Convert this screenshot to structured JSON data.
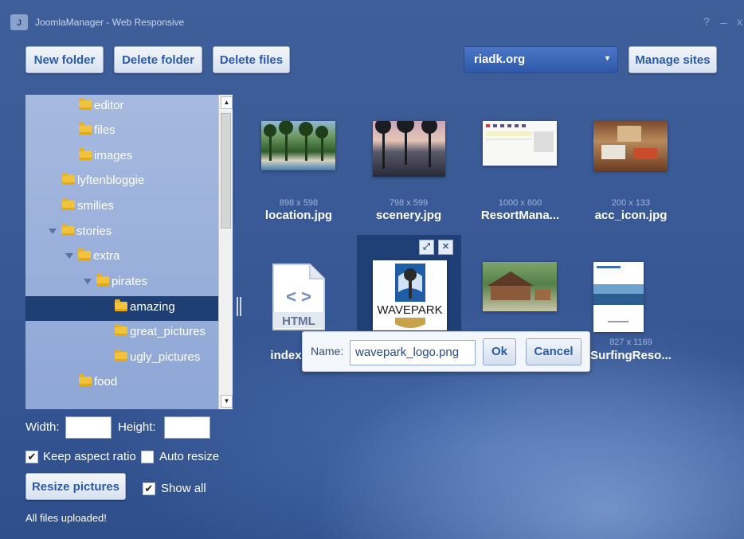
{
  "window": {
    "title": "JoomlaManager - Web Responsive",
    "icon_letter": "J",
    "help": "?",
    "minimize": "_",
    "close": "x"
  },
  "toolbar": {
    "new_folder": "New folder",
    "delete_folder": "Delete folder",
    "delete_files": "Delete files",
    "manage_sites": "Manage sites"
  },
  "site_select": {
    "value": "riadk.org",
    "arrow": "▾"
  },
  "tree": {
    "items": [
      {
        "label": "editor",
        "level": 2,
        "expanded": false,
        "selected": false
      },
      {
        "label": "files",
        "level": 2,
        "expanded": false,
        "selected": false
      },
      {
        "label": "images",
        "level": 2,
        "expanded": false,
        "selected": false
      },
      {
        "label": "lyftenbloggie",
        "level": 1,
        "expanded": false,
        "selected": false
      },
      {
        "label": "smilies",
        "level": 1,
        "expanded": false,
        "selected": false
      },
      {
        "label": "stories",
        "level": 1,
        "expanded": true,
        "selected": false
      },
      {
        "label": "extra",
        "level": 2,
        "expanded": true,
        "selected": false
      },
      {
        "label": "pirates",
        "level": 3,
        "expanded": true,
        "selected": false
      },
      {
        "label": "amazing",
        "level": 4,
        "expanded": false,
        "selected": true
      },
      {
        "label": "great_pictures",
        "level": 4,
        "expanded": false,
        "selected": false
      },
      {
        "label": "ugly_pictures",
        "level": 4,
        "expanded": false,
        "selected": false
      },
      {
        "label": "food",
        "level": 2,
        "expanded": false,
        "selected": false
      }
    ],
    "scroll_up": "▲",
    "scroll_down": "▼"
  },
  "resize": {
    "width_label": "Width:",
    "height_label": "Height:",
    "width_value": "",
    "height_value": "",
    "keep_aspect_label": "Keep aspect ratio",
    "keep_aspect_checked": true,
    "auto_resize_label": "Auto resize",
    "auto_resize_checked": false,
    "resize_button": "Resize pictures",
    "show_all_label": "Show all",
    "show_all_checked": true,
    "check_mark": "✔"
  },
  "status": "All files uploaded!",
  "files": [
    {
      "name": "location.jpg",
      "dims": "898 x 598",
      "kind": "photo-beach"
    },
    {
      "name": "scenery.jpg",
      "dims": "798 x 599",
      "kind": "photo-sunset"
    },
    {
      "name": "ResortMana...",
      "dims": "1000 x 600",
      "kind": "screenshot"
    },
    {
      "name": "acc_icon.jpg",
      "dims": "200 x 133",
      "kind": "photo-room"
    },
    {
      "name": "index",
      "dims": "",
      "kind": "html-file",
      "html_text": "HTML",
      "code_glyph": "< >"
    },
    {
      "name": "",
      "dims": "",
      "kind": "logo",
      "logo_text": "WAVEPARK"
    },
    {
      "name": "",
      "dims": "",
      "kind": "photo-house"
    },
    {
      "name": "SurfingReso...",
      "dims": "827 x 1169",
      "kind": "document"
    }
  ],
  "rename_dialog": {
    "name_label": "Name:",
    "name_value": "wavepark_logo.png",
    "ok": "Ok",
    "cancel": "Cancel"
  },
  "selected_tools": {
    "expand_icon": "⤢",
    "close_icon": "✕"
  },
  "colors": {
    "accent": "#2a5ba8",
    "selection": "#1e3f74",
    "background": "#3a5a97"
  }
}
